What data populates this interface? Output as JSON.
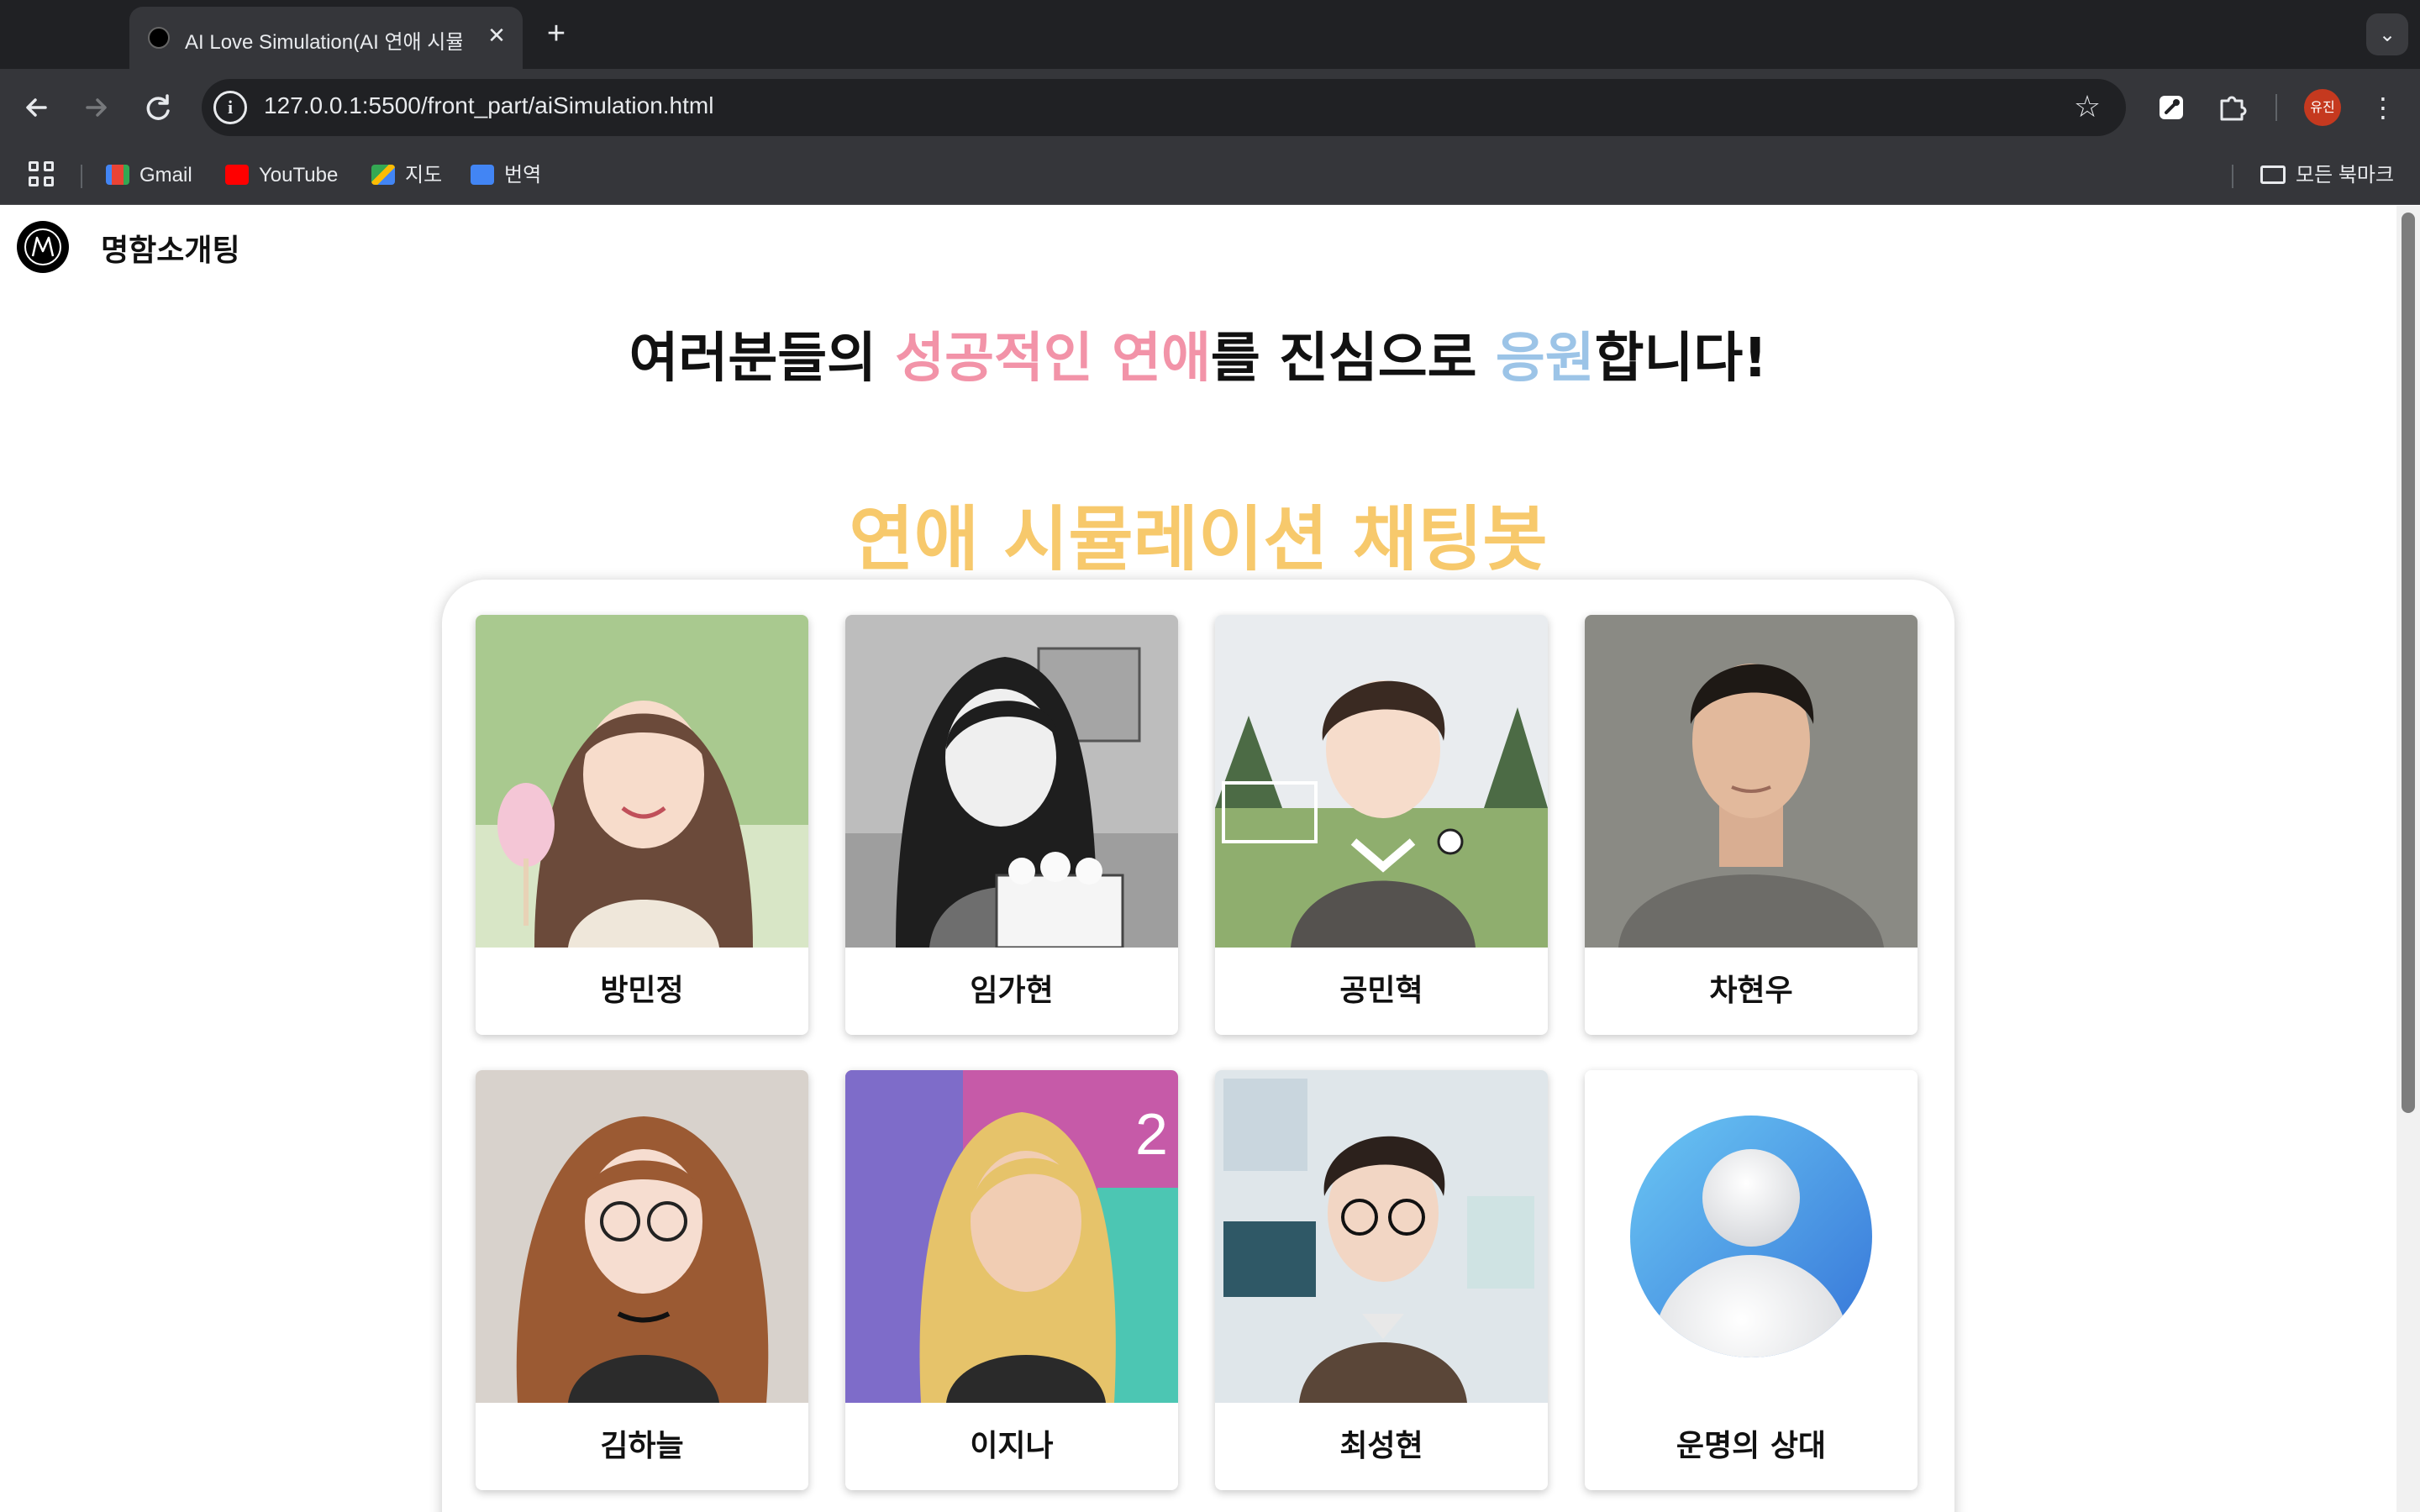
{
  "browser": {
    "tab_title": "AI Love Simulation(AI 연애 시뮬",
    "tab_close": "✕",
    "new_tab": "+",
    "tab_menu": "⌄",
    "url": "127.0.0.1:5500/front_part/aiSimulation.html",
    "site_info": "i",
    "profile_label": "유진",
    "bookmarks": [
      {
        "label": "Gmail",
        "icon": "gmail-icon"
      },
      {
        "label": "YouTube",
        "icon": "youtube-icon"
      },
      {
        "label": "지도",
        "icon": "maps-icon"
      },
      {
        "label": "번역",
        "icon": "translate-icon"
      }
    ],
    "all_bookmarks": "모든 북마크"
  },
  "site": {
    "brand": "명함소개팅",
    "headline": {
      "part1": "여러분들의 ",
      "pink": "성공적인 연애",
      "part2": "를 진심으로 ",
      "blue": "응원",
      "part3": "합니다!"
    },
    "subtitle": "연애 시뮬레이션 채팅봇"
  },
  "characters": [
    {
      "name": "방민정"
    },
    {
      "name": "임가현"
    },
    {
      "name": "공민혁"
    },
    {
      "name": "차현우"
    },
    {
      "name": "김하늘"
    },
    {
      "name": "이지나"
    },
    {
      "name": "최성현"
    },
    {
      "name": "운명의 상대"
    }
  ],
  "colors": {
    "accent_pink": "#f293a8",
    "accent_blue": "#9cc4e7",
    "accent_yellow": "#f7c96c",
    "chrome_dark": "#202124",
    "chrome_mid": "#35363a"
  }
}
